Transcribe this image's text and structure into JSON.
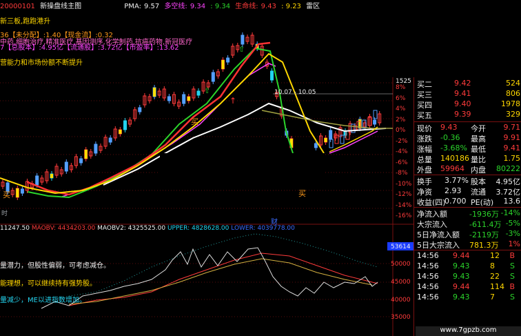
{
  "topbar": {
    "code_text": "20000101",
    "chart_title": "新操盘线主图",
    "pma_label": "PMA:",
    "pma_value": "9.57",
    "duo_label": "多空线:",
    "duo_value": "9.34",
    "v3": ": 9.34",
    "sheng_label": "生命线:",
    "sheng_value": "9.43",
    "v5": ": 9.23",
    "last": "雷区"
  },
  "notes": {
    "n1": "新三板,跑跑港升",
    "n2": "36【未分配】:1.40【现金流】:0.32",
    "n3": "中药,细胞治疗,精准医疗,基因测序,化学制药,抗癌药物,新冠医疗",
    "n4": "7【总股本】:4.95亿【流通股】:3.72亿【市盈率】:13.62",
    "n5": "营能力和市场份额不断提升",
    "buy1": "买",
    "buy2": "买",
    "buy3": "买",
    "shi": "时",
    "cai": "财",
    "range_label": "10.07 - 10.05"
  },
  "axis_right": [
    "1525",
    "8%",
    "6%",
    "4%",
    "2%",
    "0%",
    "-2%",
    "-4%",
    "-6%",
    "-8%",
    "-10%",
    "-12%",
    "-14%",
    "-16%"
  ],
  "osc": {
    "header_prefix": "11247.50",
    "maobv": "MAOBV: 4434203.00",
    "maobv2": "MAOBV2: 4325525.00",
    "upper": "UPPER: 4828628.00",
    "lower": "LOWER: 4039778.00",
    "note1": "量潜力，但股性偏弱，可考虑减仓。",
    "note2": "能理想，可以继续持有强势股。",
    "note3": "量减少，ME以进指数增加。",
    "axis": [
      "53614",
      "50000",
      "45000",
      "40000",
      "35000"
    ]
  },
  "quote": {
    "bids": [
      {
        "label": "买二",
        "price": "9.42",
        "vol": "524"
      },
      {
        "label": "买三",
        "price": "9.41",
        "vol": "806"
      },
      {
        "label": "买四",
        "price": "9.40",
        "vol": "1978"
      },
      {
        "label": "买五",
        "price": "9.39",
        "vol": "329"
      }
    ],
    "stats": [
      {
        "l1": "现价",
        "v1": "9.43",
        "l2": "今开",
        "v2": "9.71"
      },
      {
        "l1": "涨跌",
        "v1": "-0.36",
        "l2": "最高",
        "v2": "9.91"
      },
      {
        "l1": "涨幅",
        "v1": "-3.68%",
        "l2": "最低",
        "v2": "9.41"
      },
      {
        "l1": "总量",
        "v1": "140186",
        "l2": "量比",
        "v2": "1.75"
      },
      {
        "l1": "外盘",
        "v1": "59964",
        "l2": "内盘",
        "v2": "80222"
      }
    ],
    "fund": [
      {
        "l1": "换手",
        "v1": "3.77%",
        "l2": "股本",
        "v2": "4.95亿"
      },
      {
        "l1": "净资",
        "v1": "2.93",
        "l2": "流通",
        "v2": "3.72亿"
      },
      {
        "l1": "收益(四)",
        "v1": "0.700",
        "l2": "PE(动)",
        "v2": "13.6"
      }
    ],
    "flows": [
      {
        "label": "净流入额",
        "value": "-1936万",
        "pct": "-14%"
      },
      {
        "label": "大宗流入",
        "value": "-611.4万",
        "pct": "-5%"
      },
      {
        "label": "5日净流入额",
        "value": "-2119万",
        "pct": "-3%"
      },
      {
        "label": "5日大宗流入",
        "value": "781.3万",
        "pct": "1%"
      }
    ],
    "ticks": [
      {
        "time": "14:56",
        "price": "9.44",
        "vol": "12",
        "side": "B"
      },
      {
        "time": "14:56",
        "price": "9.43",
        "vol": "8",
        "side": "S"
      },
      {
        "time": "14:56",
        "price": "9.43",
        "vol": "22",
        "side": "S"
      },
      {
        "time": "14:56",
        "price": "9.44",
        "vol": "114",
        "side": "B"
      },
      {
        "time": "14:56",
        "price": "9.43",
        "vol": "7",
        "side": "S"
      }
    ]
  },
  "watermark": "www.7gpzb.com"
}
